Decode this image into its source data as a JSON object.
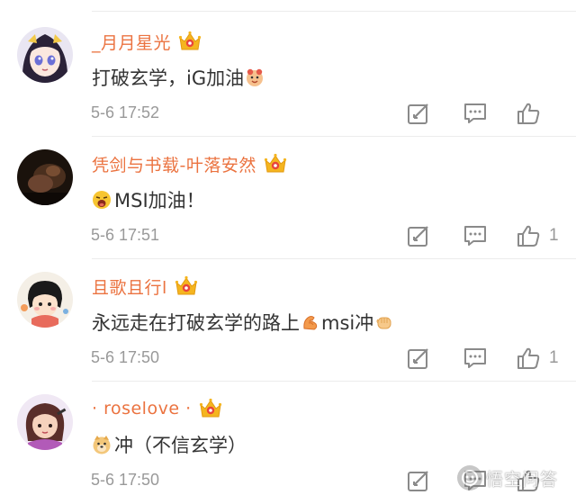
{
  "comments": [
    {
      "username": "_月月星光",
      "text": "打破玄学，iG加油",
      "emoji_before": null,
      "emoji_after": "cheer-emoji",
      "timestamp": "5-6 17:52",
      "likes": ""
    },
    {
      "username": "凭剑与书载-叶落安然",
      "text": "MSI加油！",
      "emoji_before": "shout-emoji",
      "emoji_after": null,
      "timestamp": "5-6 17:51",
      "likes": "1"
    },
    {
      "username": "且歌且行l",
      "text": "永远走在打破玄学的路上",
      "text_b": "msi冲",
      "emoji_middle": "strong-arm-emoji",
      "emoji_after": "fist-emoji",
      "timestamp": "5-6 17:50",
      "likes": "1"
    },
    {
      "username": "· roselove ·",
      "text": "冲（不信玄学）",
      "emoji_before": "doge-emoji",
      "emoji_after": null,
      "timestamp": "5-6 17:50",
      "likes": ""
    }
  ],
  "icons": {
    "vip": "vip-crown-icon",
    "repost": "repost-icon",
    "comment": "comment-icon",
    "like": "like-icon"
  },
  "colors": {
    "username": "#eb7340",
    "meta": "#999999",
    "text": "#333333",
    "vip_gold": "#f5b51f",
    "vip_red": "#e8453c"
  },
  "watermark": {
    "text": "悟空问答"
  }
}
